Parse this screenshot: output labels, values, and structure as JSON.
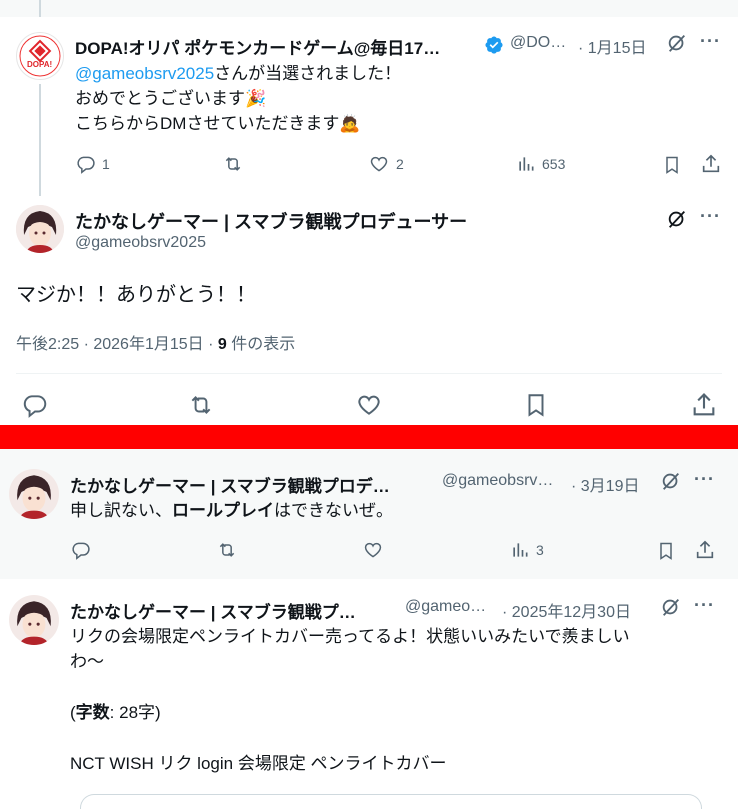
{
  "tweet1": {
    "author": "DOPA!オリパ ポケモンカードゲーム@毎日17…",
    "handle": "@DO…",
    "date": "· 1月15日",
    "mention": "@gameobsrv2025",
    "line1_rest": "さんが当選されました！",
    "line2": "おめでとうございます🎉",
    "line3": "こちらからDMさせていただきます🙇",
    "avatar_text": "DOPA!",
    "replies": "1",
    "likes": "2",
    "views": "653"
  },
  "focus": {
    "author": "たかなしゲーマー | スマブラ観戦プロデューサー",
    "handle": "@gameobsrv2025",
    "text": "マジか！！ありがとう！！",
    "time": "午後2:25 · 2026年1月15日 · ",
    "views_num": "9",
    "views_label": " 件の表示"
  },
  "reply1": {
    "author": "たかなしゲーマー | スマブラ観戦プロデ…",
    "handle": "@gameobsrv…",
    "date": "· 3月19日",
    "text_a": "申し訳ない、",
    "text_b": "ロールプレイ",
    "text_c": "はできないぜ。",
    "views": "3"
  },
  "reply2": {
    "author": "たかなしゲーマー | スマブラ観戦プ…",
    "handle": "@gameo…",
    "date": "· 2025年12月30日",
    "line1": "リクの会場限定ペンライトカバー売ってるよ！状態いいみたいで羨ましい",
    "line2": "わ〜",
    "line3_open": "(",
    "line3_bold": "字数",
    "line3_rest": ": 28字)",
    "line4": "NCT WISH リク login 会場限定 ペンライトカバー"
  },
  "colors": {
    "accent": "#1d9bf0",
    "divider_red": "#ff0000",
    "muted": "#536471"
  }
}
